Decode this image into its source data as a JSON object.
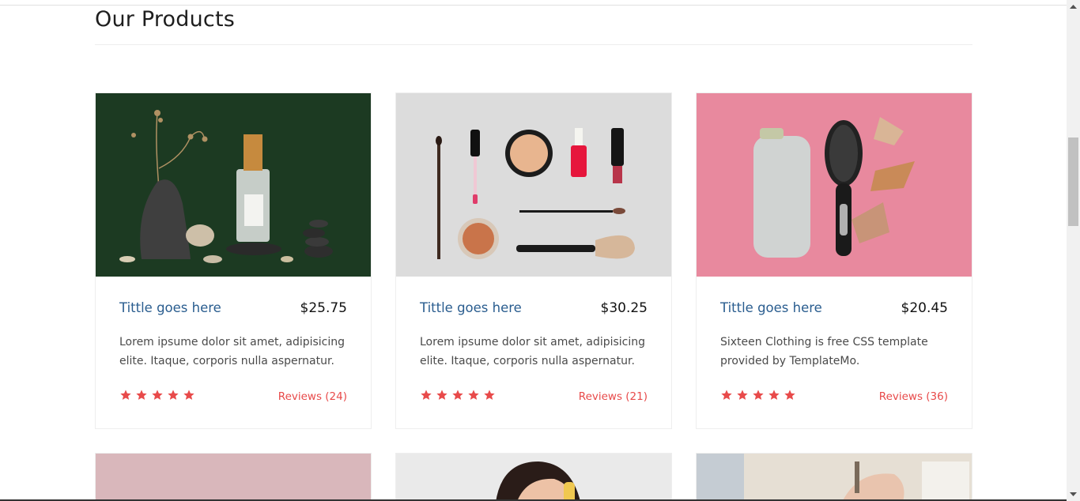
{
  "section": {
    "title": "Our Products"
  },
  "products": [
    {
      "title": "Tittle goes here",
      "price": "$25.75",
      "description": "Lorem ipsume dolor sit amet, adipisicing elite. Itaque, corporis nulla aspernatur.",
      "rating": 5,
      "reviews": "Reviews (24)",
      "image": "perfume-bottle-stones-dark-green"
    },
    {
      "title": "Tittle goes here",
      "price": "$30.25",
      "description": "Lorem ipsume dolor sit amet, adipisicing elite. Itaque, corporis nulla aspernatur.",
      "rating": 5,
      "reviews": "Reviews (21)",
      "image": "makeup-brushes-flatlay-grey"
    },
    {
      "title": "Tittle goes here",
      "price": "$20.45",
      "description": "Sixteen Clothing is free CSS template provided by TemplateMo.",
      "rating": 5,
      "reviews": "Reviews (36)",
      "image": "shampoo-hairbrush-shells-pink"
    }
  ],
  "next_row_images": [
    "pink-backdrop",
    "woman-face-makeup",
    "hands-nail-polish"
  ],
  "colors": {
    "title": "#2a5d8f",
    "price": "#121212",
    "star": "#e84a4a",
    "reviews": "#e84a4a"
  }
}
